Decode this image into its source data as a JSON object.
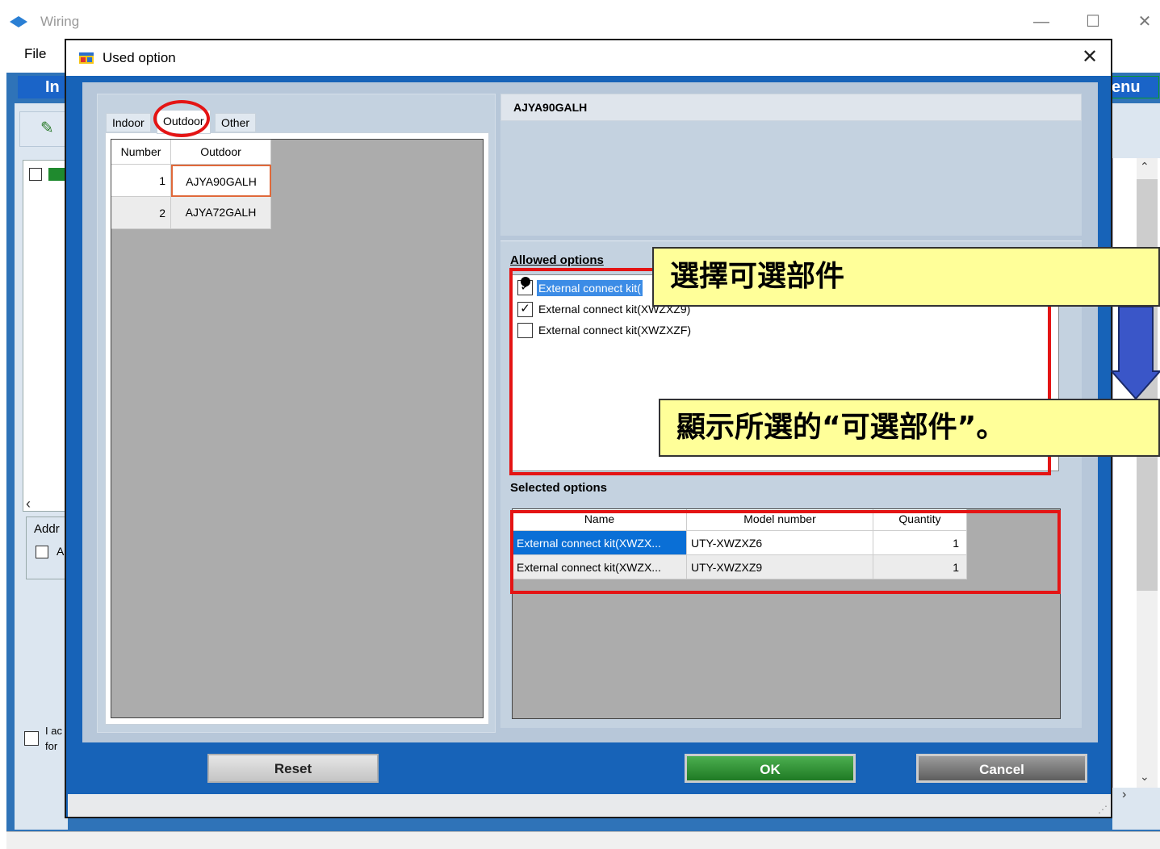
{
  "background_window": {
    "title": "Wiring",
    "menu_file": "File",
    "tab_left_fragment": "In",
    "tab_right_fragment": "enu",
    "address_label": "Addr",
    "address_checkbox_label": "A",
    "accept_line1": "I ac",
    "accept_line2": "for",
    "minimize": "—",
    "maximize": "☐",
    "close": "✕"
  },
  "dialog": {
    "title": "Used option",
    "close": "✕",
    "tabs": [
      {
        "label": "Indoor"
      },
      {
        "label": "Outdoor",
        "selected": true
      },
      {
        "label": "Other"
      }
    ],
    "outdoor_grid": {
      "headers": [
        "Number",
        "Outdoor"
      ],
      "rows": [
        {
          "number": "1",
          "outdoor": "AJYA90GALH",
          "selected": true
        },
        {
          "number": "2",
          "outdoor": "AJYA72GALH"
        }
      ]
    },
    "selected_model": "AJYA90GALH",
    "allowed_options": {
      "label": "Allowed options",
      "items": [
        {
          "label": "External connect kit(",
          "checked": true,
          "highlighted": true
        },
        {
          "label": "External connect kit(XWZXZ9)",
          "checked": true
        },
        {
          "label": "External connect kit(XWZXZF)",
          "checked": false
        }
      ]
    },
    "selected_options": {
      "label": "Selected options",
      "headers": [
        "Name",
        "Model number",
        "Quantity"
      ],
      "rows": [
        {
          "name": "External connect kit(XWZX...",
          "model": "UTY-XWZXZ6",
          "quantity": "1"
        },
        {
          "name": "External connect kit(XWZX...",
          "model": "UTY-XWZXZ9",
          "quantity": "1"
        }
      ]
    },
    "buttons": {
      "reset": "Reset",
      "ok": "OK",
      "cancel": "Cancel"
    }
  },
  "annotations": {
    "callout_1": "選擇可選部件",
    "callout_2": "顯示所選的“可選部件”。",
    "highlight_color": "#e41414",
    "callout_bg": "#ffff99"
  },
  "colors": {
    "dialog_frame": "#1763b8",
    "selection_blue": "#0a6fd6",
    "ok_green": "#1f7a24"
  }
}
